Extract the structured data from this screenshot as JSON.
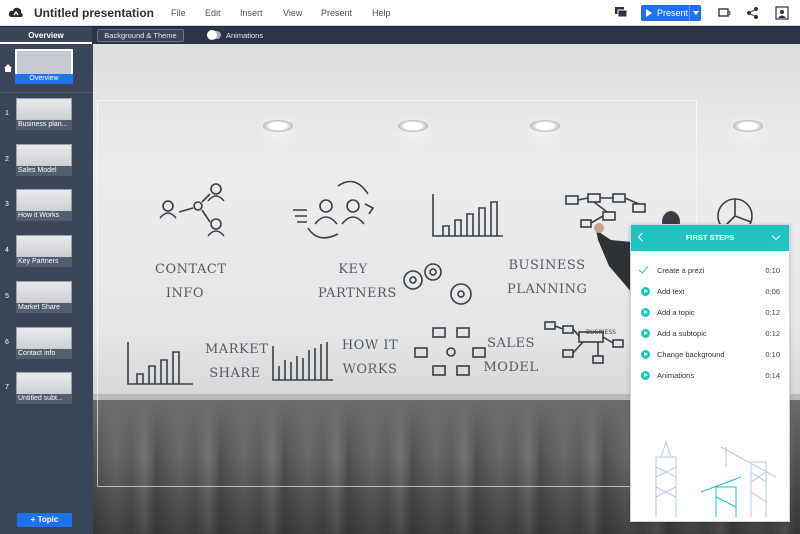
{
  "app": {
    "doc_title": "Untitled presentation",
    "menu": [
      "File",
      "Edit",
      "Insert",
      "View",
      "Present",
      "Help"
    ],
    "present_label": "Present"
  },
  "toolbar": {
    "overview_tab": "Overview",
    "bg_theme_label": "Background & Theme",
    "animations_label": "Animations",
    "animations_on": false
  },
  "sidebar": {
    "overview_label": "Overview",
    "topics": [
      {
        "num": "1",
        "label": "Business plan..."
      },
      {
        "num": "2",
        "label": "Sales Model"
      },
      {
        "num": "3",
        "label": "How it Works"
      },
      {
        "num": "4",
        "label": "Key Partners"
      },
      {
        "num": "5",
        "label": "Market Share"
      },
      {
        "num": "6",
        "label": "Contact info"
      },
      {
        "num": "7",
        "label": "Untitled subt..."
      }
    ],
    "add_topic_label": "+ Topic"
  },
  "canvas": {
    "labels": {
      "contact": "CONTACT INFO",
      "partners": "KEY PARTNERS",
      "business": "BUSINESS PLANNING",
      "market": "MARKET SHARE",
      "how": "HOW IT WORKS",
      "sales": "SALES MODEL",
      "business_small": "BUSINESS"
    }
  },
  "first_steps": {
    "title": "FIRST STEPS",
    "steps": [
      {
        "label": "Create a prezi",
        "duration": "0:10",
        "done": true
      },
      {
        "label": "Add text",
        "duration": "0:06",
        "done": false
      },
      {
        "label": "Add a topic",
        "duration": "0:12",
        "done": false
      },
      {
        "label": "Add a subtopic",
        "duration": "0:12",
        "done": false
      },
      {
        "label": "Change background",
        "duration": "0:10",
        "done": false
      },
      {
        "label": "Animations",
        "duration": "0:14",
        "done": false
      }
    ]
  },
  "colors": {
    "accent": "#1e73ec",
    "teal": "#21c3c0",
    "sidebar": "#3b4558",
    "toolbar": "#2a3444"
  },
  "icons": [
    "cloud-logo-icon",
    "comment-icon",
    "play-icon",
    "share-screen-icon",
    "share-icon",
    "collaborators-icon",
    "home-icon"
  ]
}
